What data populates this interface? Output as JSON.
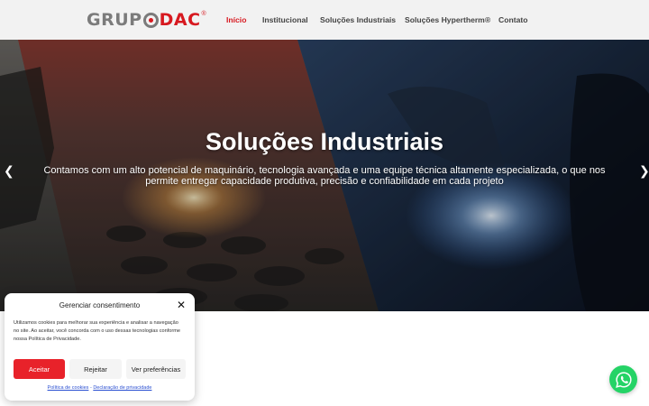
{
  "brand": {
    "logo_text_left": "GRUP",
    "logo_text_right": "DAC",
    "logo_mark": "®"
  },
  "nav": {
    "items": [
      {
        "label": "Início",
        "active": true
      },
      {
        "label": "Institucional",
        "active": false
      },
      {
        "label": "Soluções Industriais",
        "active": false
      },
      {
        "label": "Soluções Hypertherm®",
        "active": false
      },
      {
        "label": "Contato",
        "active": false
      }
    ]
  },
  "hero": {
    "title": "Soluções Industriais",
    "subtitle": "Contamos com um alto potencial de maquinário, tecnologia avançada e uma equipe técnica altamente especializada, o que nos permite entregar capacidade produtiva, precisão e confiabilidade em cada projeto",
    "prev_icon": "chevron-left-icon",
    "next_icon": "chevron-right-icon"
  },
  "cookie_banner": {
    "title": "Gerenciar consentimento",
    "text": "Utilizamos cookies para melhorar sua experiência e analisar a navegação no site. Ao aceitar, você concorda com o uso dessas tecnologias conforme nossa Política de Privacidade.",
    "accept_label": "Aceitar",
    "reject_label": "Rejeitar",
    "prefs_label": "Ver preferências",
    "link_cookies": "Política de cookies",
    "link_privacy": "Declaração de privacidade"
  },
  "colors": {
    "brand_red": "#d71920",
    "accept_red": "#e8222a",
    "whatsapp_green": "#25d366",
    "header_bg": "#f2f2f2"
  },
  "whatsapp": {
    "icon": "whatsapp-icon"
  }
}
